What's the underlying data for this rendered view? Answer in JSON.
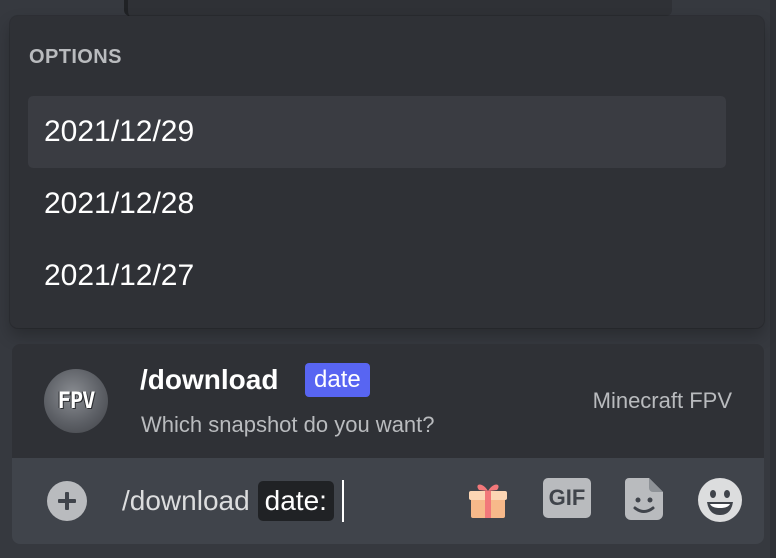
{
  "options_popup": {
    "header": "OPTIONS",
    "items": [
      {
        "label": "2021/12/29",
        "selected": true
      },
      {
        "label": "2021/12/28",
        "selected": false
      },
      {
        "label": "2021/12/27",
        "selected": false
      }
    ]
  },
  "command_preview": {
    "avatar_text": "FPV",
    "command_name": "/download",
    "option_name": "date",
    "description": "Which snapshot do you want?",
    "app_name": "Minecraft FPV"
  },
  "input_bar": {
    "command_text": "/download",
    "option_token": "date:",
    "icons": [
      "plus-icon",
      "gift-icon",
      "gif-icon",
      "sticker-icon",
      "emoji-icon"
    ],
    "gif_label": "GIF"
  },
  "colors": {
    "background": "#36393f",
    "popup": "#2f3136",
    "input": "#40444b",
    "accent": "#5865f2",
    "selected_row": "#3a3c42",
    "muted_text": "#b9bbbe"
  }
}
